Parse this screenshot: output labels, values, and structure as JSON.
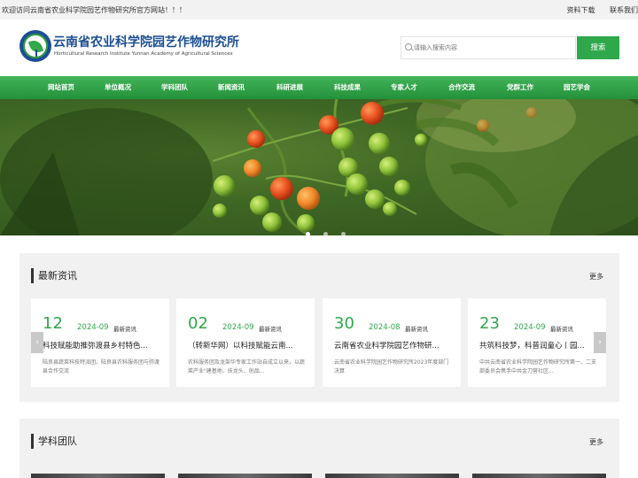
{
  "topbar": {
    "welcome": "欢迎访问云南省农业科学院园艺作物研究所官方网站！！！",
    "links": [
      "资料下载",
      "联系我们"
    ]
  },
  "header": {
    "title": "云南省农业科学院园艺作物研究所",
    "subtitle": "Horticultural Research Institute Yunnan Academy of Agricultural Sciences",
    "search_placeholder": "请输入搜索内容",
    "search_button": "搜索"
  },
  "nav": {
    "items": [
      "网站首页",
      "单位概况",
      "学科团队",
      "新闻资讯",
      "科研进展",
      "科技成果",
      "专家人才",
      "合作交流",
      "党群工作",
      "园艺学会"
    ]
  },
  "banner": {
    "slide_count": 3,
    "active_slide": 1
  },
  "news": {
    "heading": "最新资讯",
    "more": "更多",
    "prev_arrow": "‹",
    "next_arrow": "›",
    "cards": [
      {
        "day": "12",
        "ym": "2024-09",
        "category": "最新资讯",
        "title": "科技赋能助推弥渡县乡村特色...",
        "desc": "陆良县蔬菜科技特派团、陆良县农科服务团与弥渡县合作交流"
      },
      {
        "day": "02",
        "ym": "2024-09",
        "category": "最新资讯",
        "title": "（转新华网）以科技赋能云南...",
        "desc": "农科服务团及龙架华专家工作站自成立以来，以蔬菜产业\"建基地、扶龙头、创品..."
      },
      {
        "day": "30",
        "ym": "2024-08",
        "category": "最新资讯",
        "title": "云南省农业科学院园艺作物研...",
        "desc": "云南省农业科学院园艺作物研究所2023年度部门决算"
      },
      {
        "day": "23",
        "ym": "2024-09",
        "category": "最新资讯",
        "title": "共筑科技梦，科普润童心丨园...",
        "desc": "中共云南省农业科学院园艺作物研究所第一、二支部委员会携手中共金刀营社区..."
      }
    ]
  },
  "team": {
    "heading": "学科团队",
    "more": "更多"
  },
  "colors": {
    "brand_green": "#2fa84b",
    "brand_blue": "#1c4f94",
    "nav_green": "#23913a"
  }
}
